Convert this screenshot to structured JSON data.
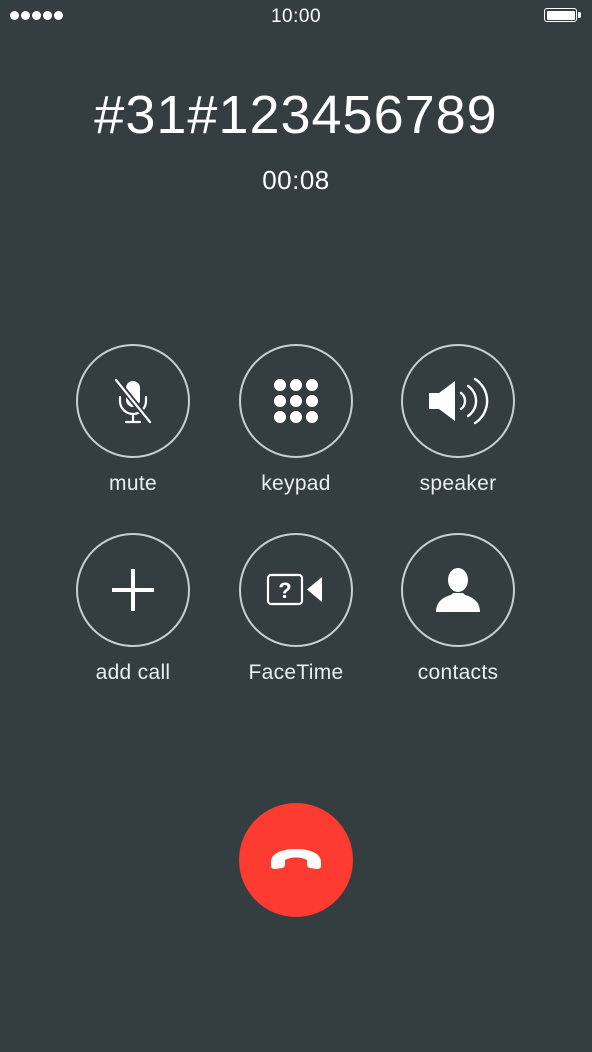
{
  "status_bar": {
    "time": "10:00",
    "signal_strength": 5,
    "battery_level": 1.0,
    "signal_icon": "signal-dots-icon",
    "battery_icon": "battery-icon"
  },
  "call": {
    "number": "#31#123456789",
    "duration": "00:08"
  },
  "controls": [
    {
      "id": "mute",
      "label": "mute",
      "icon": "microphone-muted-icon"
    },
    {
      "id": "keypad",
      "label": "keypad",
      "icon": "keypad-grid-icon"
    },
    {
      "id": "speaker",
      "label": "speaker",
      "icon": "speaker-icon"
    },
    {
      "id": "add-call",
      "label": "add call",
      "icon": "plus-icon"
    },
    {
      "id": "facetime",
      "label": "FaceTime",
      "icon": "facetime-video-question-icon"
    },
    {
      "id": "contacts",
      "label": "contacts",
      "icon": "person-silhouette-icon"
    }
  ],
  "end_call": {
    "icon": "phone-hangup-icon",
    "color": "#fd3b30"
  },
  "colors": {
    "background": "#343e41",
    "button_ring": "#c6cfd2",
    "text": "#ffffff"
  }
}
